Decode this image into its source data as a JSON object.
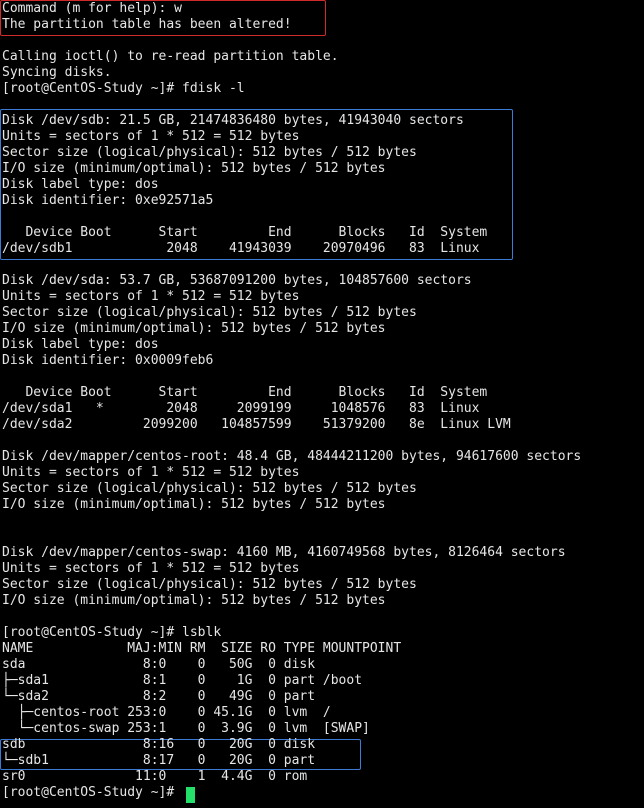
{
  "colors": {
    "background": "#000000",
    "text": "#e6e6e6",
    "highlight_red": "#d12a2a",
    "highlight_blue": "#3b7bd6",
    "cursor": "#22e06a"
  },
  "terminal": {
    "lines": [
      "Command (m for help): w",
      "The partition table has been altered!",
      "",
      "Calling ioctl() to re-read partition table.",
      "Syncing disks.",
      "[root@CentOS-Study ~]# fdisk -l",
      "",
      "Disk /dev/sdb: 21.5 GB, 21474836480 bytes, 41943040 sectors",
      "Units = sectors of 1 * 512 = 512 bytes",
      "Sector size (logical/physical): 512 bytes / 512 bytes",
      "I/O size (minimum/optimal): 512 bytes / 512 bytes",
      "Disk label type: dos",
      "Disk identifier: 0xe92571a5",
      "",
      "   Device Boot      Start         End      Blocks   Id  System",
      "/dev/sdb1            2048    41943039    20970496   83  Linux",
      "",
      "Disk /dev/sda: 53.7 GB, 53687091200 bytes, 104857600 sectors",
      "Units = sectors of 1 * 512 = 512 bytes",
      "Sector size (logical/physical): 512 bytes / 512 bytes",
      "I/O size (minimum/optimal): 512 bytes / 512 bytes",
      "Disk label type: dos",
      "Disk identifier: 0x0009feb6",
      "",
      "   Device Boot      Start         End      Blocks   Id  System",
      "/dev/sda1   *        2048     2099199     1048576   83  Linux",
      "/dev/sda2         2099200   104857599    51379200   8e  Linux LVM",
      "",
      "Disk /dev/mapper/centos-root: 48.4 GB, 48444211200 bytes, 94617600 sectors",
      "Units = sectors of 1 * 512 = 512 bytes",
      "Sector size (logical/physical): 512 bytes / 512 bytes",
      "I/O size (minimum/optimal): 512 bytes / 512 bytes",
      "",
      "",
      "Disk /dev/mapper/centos-swap: 4160 MB, 4160749568 bytes, 8126464 sectors",
      "Units = sectors of 1 * 512 = 512 bytes",
      "Sector size (logical/physical): 512 bytes / 512 bytes",
      "I/O size (minimum/optimal): 512 bytes / 512 bytes",
      "",
      "[root@CentOS-Study ~]# lsblk",
      "NAME            MAJ:MIN RM  SIZE RO TYPE MOUNTPOINT",
      "sda               8:0    0   50G  0 disk",
      "├─sda1            8:1    0    1G  0 part /boot",
      "└─sda2            8:2    0   49G  0 part",
      "  ├─centos-root 253:0    0 45.1G  0 lvm  /",
      "  └─centos-swap 253:1    0  3.9G  0 lvm  [SWAP]",
      "sdb               8:16   0   20G  0 disk",
      "└─sdb1            8:17   0   20G  0 part",
      "sr0              11:0    1  4.4G  0 rom",
      "[root@CentOS-Study ~]# "
    ]
  }
}
